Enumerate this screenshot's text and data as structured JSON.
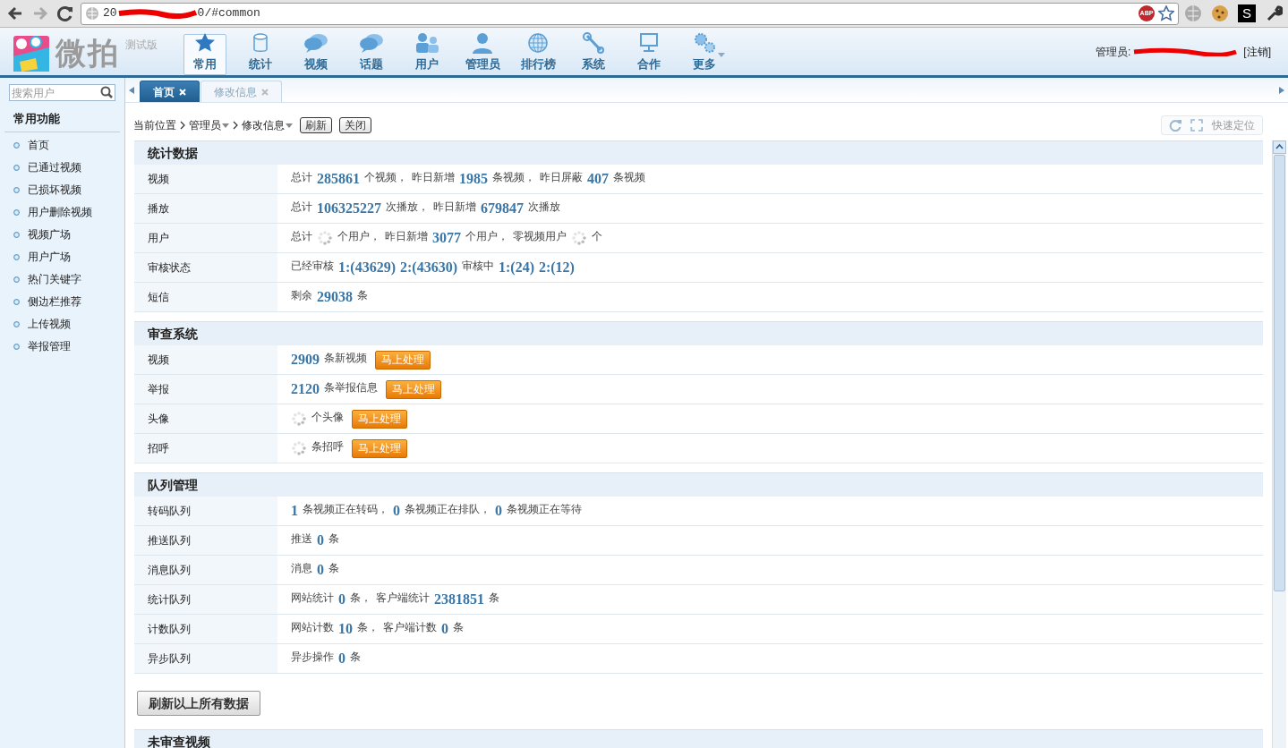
{
  "browser": {
    "url_start": "20",
    "url_end": "0/#common",
    "extensions": [
      {
        "kind": "abp",
        "text": "ABP"
      },
      {
        "kind": "star"
      },
      {
        "kind": "globe"
      },
      {
        "kind": "cookie"
      },
      {
        "kind": "s",
        "text": "S"
      },
      {
        "kind": "wrench"
      }
    ]
  },
  "header": {
    "logo_text": "微拍",
    "edition": "测试版",
    "admin_label": "管理员:",
    "logout": "[注销]"
  },
  "nav": [
    {
      "label": "常用",
      "selected": true,
      "dropdown": false
    },
    {
      "label": "统计",
      "selected": false,
      "dropdown": false
    },
    {
      "label": "视频",
      "selected": false,
      "dropdown": false
    },
    {
      "label": "话题",
      "selected": false,
      "dropdown": false
    },
    {
      "label": "用户",
      "selected": false,
      "dropdown": false
    },
    {
      "label": "管理员",
      "selected": false,
      "dropdown": false
    },
    {
      "label": "排行榜",
      "selected": false,
      "dropdown": false
    },
    {
      "label": "系统",
      "selected": false,
      "dropdown": false
    },
    {
      "label": "合作",
      "selected": false,
      "dropdown": false
    },
    {
      "label": "更多",
      "selected": false,
      "dropdown": true
    }
  ],
  "sidebar": {
    "search_placeholder": "搜索用户",
    "title": "常用功能",
    "items": [
      "首页",
      "已通过视频",
      "已损坏视频",
      "用户删除视频",
      "视频广场",
      "用户广场",
      "热门关键字",
      "侧边栏推荐",
      "上传视频",
      "举报管理"
    ]
  },
  "tabs": [
    {
      "label": "首页",
      "selected": true
    },
    {
      "label": "修改信息",
      "selected": false
    }
  ],
  "breadcrumb": {
    "items": [
      {
        "text": "当前位置",
        "dropdown": false
      },
      {
        "text": "管理员",
        "dropdown": true
      },
      {
        "text": "修改信息",
        "dropdown": true
      }
    ],
    "buttons": [
      "刷新",
      "关闭"
    ],
    "quick_locate": "快速定位"
  },
  "sections": [
    {
      "title": "统计数据",
      "rows": [
        {
          "label": "视频",
          "value": [
            {
              "kind": "text",
              "text": "总计"
            },
            {
              "kind": "num",
              "text": "285861"
            },
            {
              "kind": "text",
              "text": "个视频，"
            },
            {
              "kind": "text",
              "text": "昨日新增"
            },
            {
              "kind": "num",
              "text": "1985"
            },
            {
              "kind": "text",
              "text": "条视频，"
            },
            {
              "kind": "text",
              "text": "昨日屏蔽"
            },
            {
              "kind": "num",
              "text": "407"
            },
            {
              "kind": "text",
              "text": "条视频"
            }
          ]
        },
        {
          "label": "播放",
          "value": [
            {
              "kind": "text",
              "text": "总计"
            },
            {
              "kind": "num",
              "text": "106325227"
            },
            {
              "kind": "text",
              "text": "次播放，"
            },
            {
              "kind": "text",
              "text": "昨日新增"
            },
            {
              "kind": "num",
              "text": "679847"
            },
            {
              "kind": "text",
              "text": "次播放"
            }
          ]
        },
        {
          "label": "用户",
          "value": [
            {
              "kind": "text",
              "text": "总计"
            },
            {
              "kind": "spinner"
            },
            {
              "kind": "text",
              "text": "个用户，"
            },
            {
              "kind": "text",
              "text": "昨日新增"
            },
            {
              "kind": "num",
              "text": "3077"
            },
            {
              "kind": "text",
              "text": "个用户，"
            },
            {
              "kind": "text",
              "text": "零视频用户"
            },
            {
              "kind": "spinner"
            },
            {
              "kind": "text",
              "text": "个"
            }
          ]
        },
        {
          "label": "审核状态",
          "value": [
            {
              "kind": "text",
              "text": "已经审核"
            },
            {
              "kind": "num",
              "text": "1:(43629)"
            },
            {
              "kind": "num",
              "text": "2:(43630)"
            },
            {
              "kind": "text",
              "text": "审核中"
            },
            {
              "kind": "num",
              "text": "1:(24)"
            },
            {
              "kind": "num",
              "text": "2:(12)"
            }
          ]
        },
        {
          "label": "短信",
          "value": [
            {
              "kind": "text",
              "text": "剩余"
            },
            {
              "kind": "num",
              "text": "29038"
            },
            {
              "kind": "text",
              "text": "条"
            }
          ]
        }
      ]
    },
    {
      "title": "审查系统",
      "rows": [
        {
          "label": "视频",
          "value": [
            {
              "kind": "num",
              "text": "2909"
            },
            {
              "kind": "text",
              "text": "条新视频"
            },
            {
              "kind": "button",
              "text": "马上处理"
            }
          ]
        },
        {
          "label": "举报",
          "value": [
            {
              "kind": "num",
              "text": "2120"
            },
            {
              "kind": "text",
              "text": "条举报信息"
            },
            {
              "kind": "button",
              "text": "马上处理"
            }
          ]
        },
        {
          "label": "头像",
          "value": [
            {
              "kind": "spinner"
            },
            {
              "kind": "text",
              "text": "个头像"
            },
            {
              "kind": "button",
              "text": "马上处理"
            }
          ]
        },
        {
          "label": "招呼",
          "value": [
            {
              "kind": "spinner"
            },
            {
              "kind": "text",
              "text": "条招呼"
            },
            {
              "kind": "button",
              "text": "马上处理"
            }
          ]
        }
      ]
    },
    {
      "title": "队列管理",
      "rows": [
        {
          "label": "转码队列",
          "value": [
            {
              "kind": "num",
              "text": "1"
            },
            {
              "kind": "text",
              "text": "条视频正在转码，"
            },
            {
              "kind": "num",
              "text": "0"
            },
            {
              "kind": "text",
              "text": "条视频正在排队，"
            },
            {
              "kind": "num",
              "text": "0"
            },
            {
              "kind": "text",
              "text": "条视频正在等待"
            }
          ]
        },
        {
          "label": "推送队列",
          "value": [
            {
              "kind": "text",
              "text": "推送"
            },
            {
              "kind": "num",
              "text": "0"
            },
            {
              "kind": "text",
              "text": "条"
            }
          ]
        },
        {
          "label": "消息队列",
          "value": [
            {
              "kind": "text",
              "text": "消息"
            },
            {
              "kind": "num",
              "text": "0"
            },
            {
              "kind": "text",
              "text": "条"
            }
          ]
        },
        {
          "label": "统计队列",
          "value": [
            {
              "kind": "text",
              "text": "网站统计"
            },
            {
              "kind": "num",
              "text": "0"
            },
            {
              "kind": "text",
              "text": "条，"
            },
            {
              "kind": "text",
              "text": "客户端统计"
            },
            {
              "kind": "num",
              "text": "2381851"
            },
            {
              "kind": "text",
              "text": "条"
            }
          ]
        },
        {
          "label": "计数队列",
          "value": [
            {
              "kind": "text",
              "text": "网站计数"
            },
            {
              "kind": "num",
              "text": "10"
            },
            {
              "kind": "text",
              "text": "条，"
            },
            {
              "kind": "text",
              "text": "客户端计数"
            },
            {
              "kind": "num",
              "text": "0"
            },
            {
              "kind": "text",
              "text": "条"
            }
          ]
        },
        {
          "label": "异步队列",
          "value": [
            {
              "kind": "text",
              "text": "异步操作"
            },
            {
              "kind": "num",
              "text": "0"
            },
            {
              "kind": "text",
              "text": "条"
            }
          ]
        }
      ]
    }
  ],
  "refresh_all": "刷新以上所有数据",
  "next_section": "未审查视频"
}
